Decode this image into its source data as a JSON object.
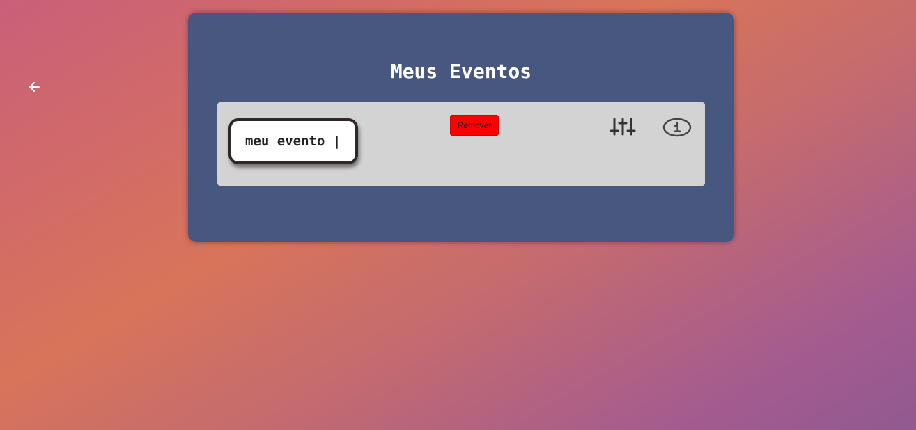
{
  "header": {
    "back_icon": "arrow-left-icon"
  },
  "panel": {
    "title": "Meus Eventos"
  },
  "events": [
    {
      "name": "meu evento |",
      "remove_label": "Remover",
      "settings_icon": "sliders-icon",
      "info_icon": "info-icon"
    }
  ],
  "colors": {
    "panel_bg": "#475780",
    "card_bg": "#d3d3d3",
    "remove_button": "#ff0000",
    "title_text": "#ffffff"
  }
}
